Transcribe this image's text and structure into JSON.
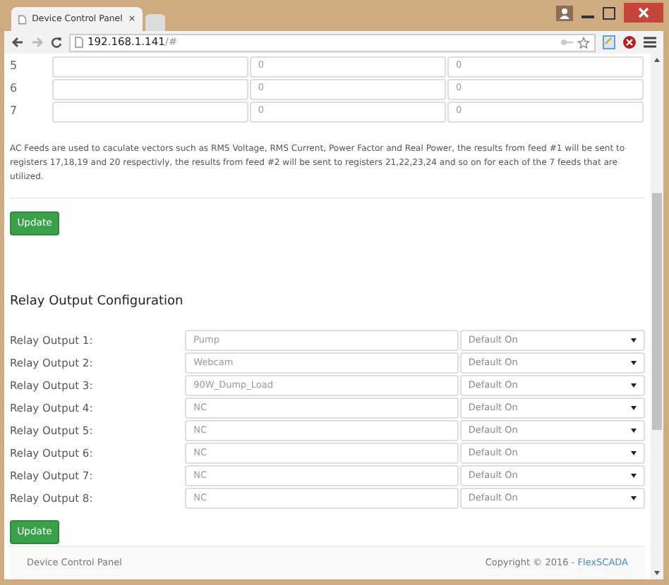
{
  "browser": {
    "tab_title": "Device Control Panel",
    "tab_close": "×",
    "url_host": "192.168.1.141",
    "url_path": "/#"
  },
  "feeds": [
    {
      "label": "5",
      "value_1": "0",
      "value_2": "0"
    },
    {
      "label": "6",
      "value_1": "0",
      "value_2": "0"
    },
    {
      "label": "7",
      "value_1": "0",
      "value_2": "0"
    }
  ],
  "feeds_note": "AC Feeds are used to caculate vectors such as RMS Voltage, RMS Current, Power Factor and Real Power, the results from feed #1 will be sent to registers 17,18,19 and 20 respectivly, the results from feed #2 will be sent to registers 21,22,23,24 and so on for each of the 7 feeds that are utilized.",
  "feeds_button": "Update",
  "relay_heading": "Relay Output Configuration",
  "relays": [
    {
      "label": "Relay Output 1:",
      "name": "Pump",
      "mode": "Default On"
    },
    {
      "label": "Relay Output 2:",
      "name": "Webcam",
      "mode": "Default On"
    },
    {
      "label": "Relay Output 3:",
      "name": "90W_Dump_Load",
      "mode": "Default On"
    },
    {
      "label": "Relay Output 4:",
      "name": "NC",
      "mode": "Default On"
    },
    {
      "label": "Relay Output 5:",
      "name": "NC",
      "mode": "Default On"
    },
    {
      "label": "Relay Output 6:",
      "name": "NC",
      "mode": "Default On"
    },
    {
      "label": "Relay Output 7:",
      "name": "NC",
      "mode": "Default On"
    },
    {
      "label": "Relay Output 8:",
      "name": "NC",
      "mode": "Default On"
    }
  ],
  "relay_button": "Update",
  "footer": {
    "left": "Device Control Panel",
    "copyright": "Copyright © 2016 - ",
    "link": "FlexSCADA"
  }
}
